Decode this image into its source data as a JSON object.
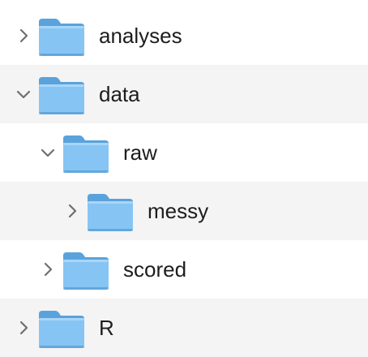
{
  "colors": {
    "folder_front": "#86c5f3",
    "folder_back": "#5aa2dc",
    "folder_edge": "#4b92cf",
    "chevron": "#6e6e73",
    "row_alt": "#f4f4f4"
  },
  "tree": {
    "items": [
      {
        "label": "analyses",
        "depth": 0,
        "expanded": false,
        "icon": "folder-icon"
      },
      {
        "label": "data",
        "depth": 0,
        "expanded": true,
        "icon": "folder-icon"
      },
      {
        "label": "raw",
        "depth": 1,
        "expanded": true,
        "icon": "folder-icon"
      },
      {
        "label": "messy",
        "depth": 2,
        "expanded": false,
        "icon": "folder-icon"
      },
      {
        "label": "scored",
        "depth": 1,
        "expanded": false,
        "icon": "folder-icon"
      },
      {
        "label": "R",
        "depth": 0,
        "expanded": false,
        "icon": "folder-icon"
      }
    ]
  }
}
